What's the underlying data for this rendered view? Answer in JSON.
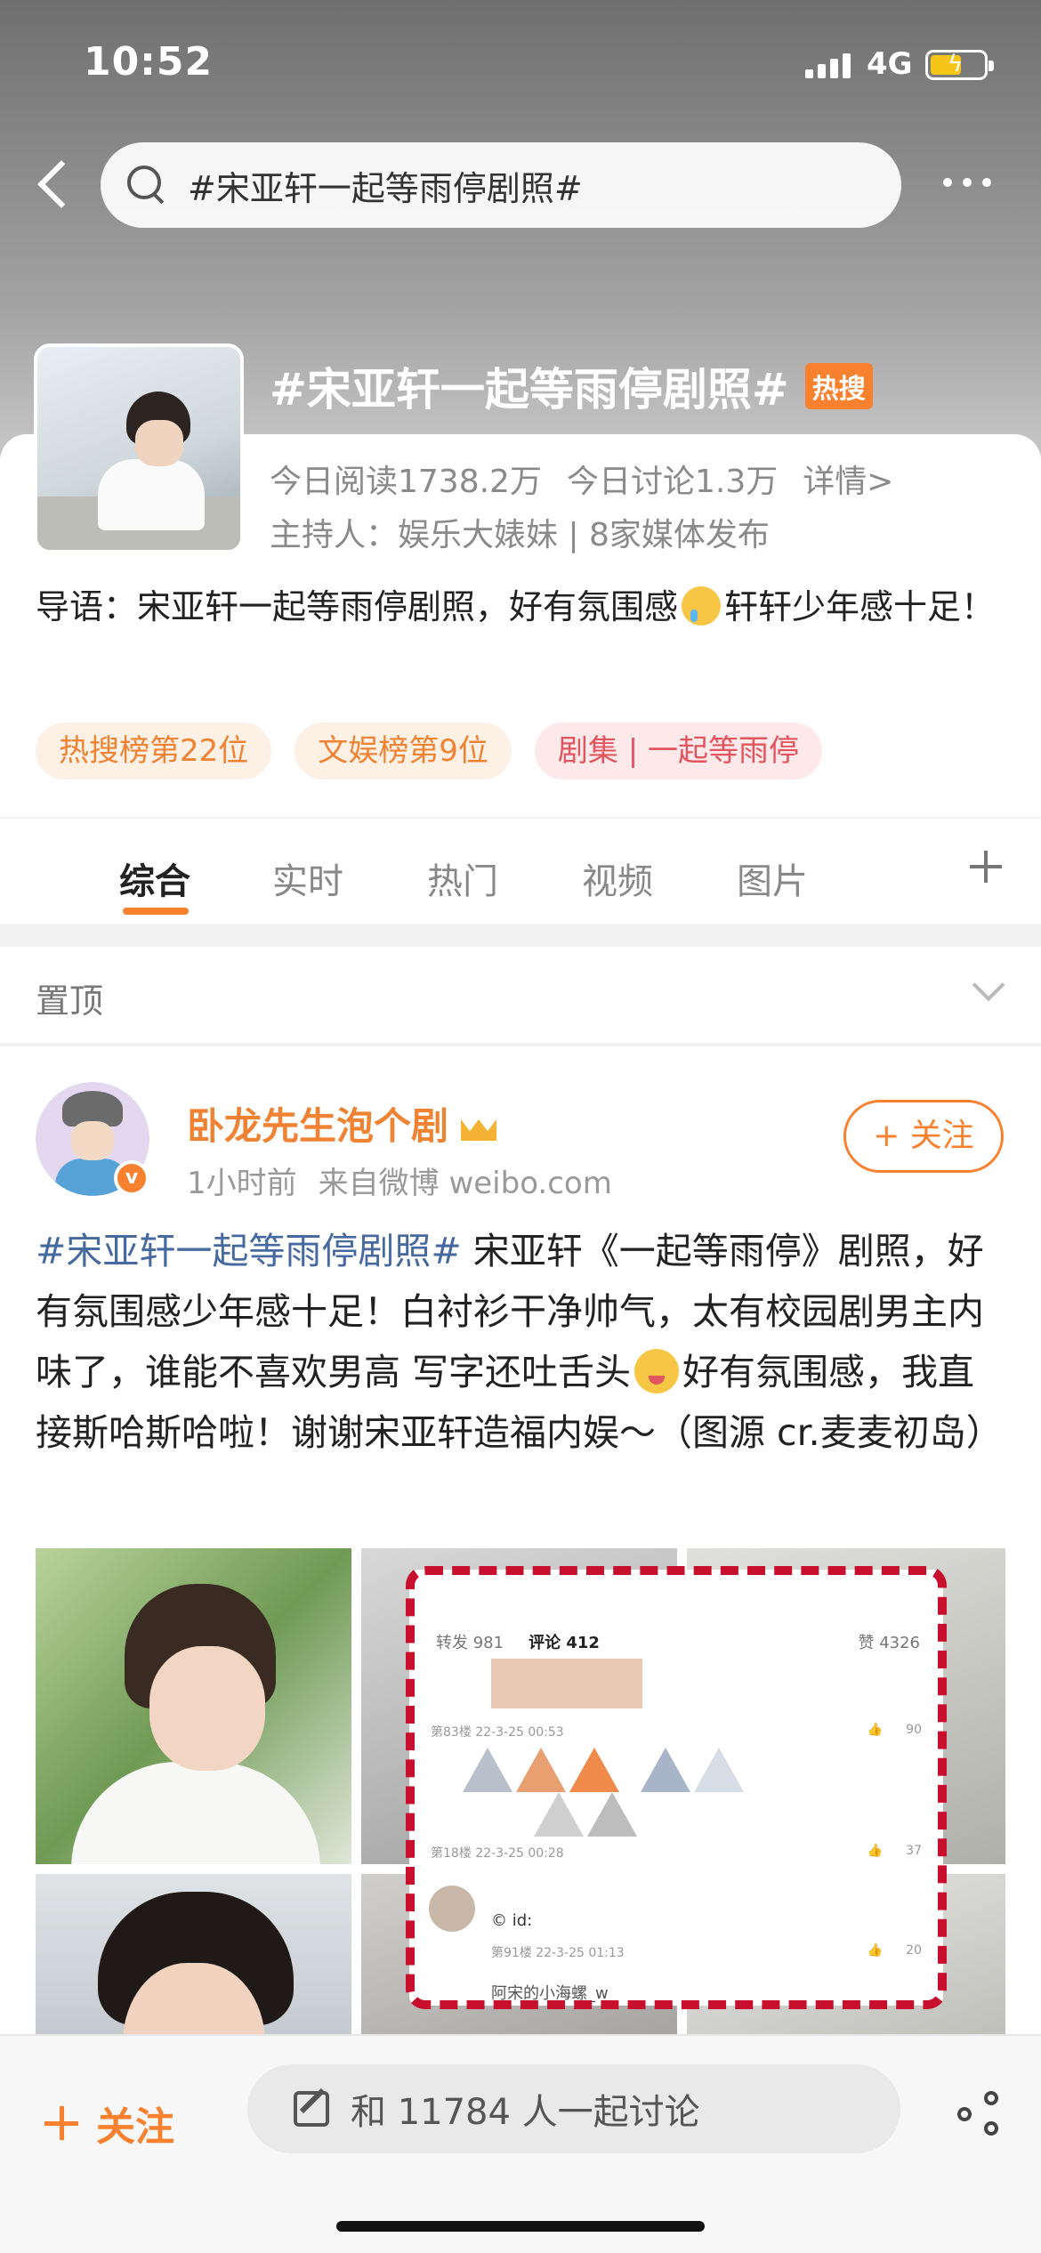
{
  "status_bar": {
    "time": "10:52",
    "network": "4G"
  },
  "search": {
    "query": "#宋亚轩一起等雨停剧照#"
  },
  "topic": {
    "title": "#宋亚轩一起等雨停剧照#",
    "hot_badge": "热搜",
    "stat_read": "今日阅读1738.2万",
    "stat_discuss": "今日讨论1.3万",
    "details_link": "详情>",
    "host": "主持人：娱乐大婊妹 | 8家媒体发布",
    "intro_prefix": "导语：宋亚轩一起等雨停剧照，好有氛围感",
    "intro_suffix": "轩轩少年感十足！",
    "tags": [
      "热搜榜第22位",
      "文娱榜第9位",
      "剧集 | 一起等雨停"
    ]
  },
  "tabs": [
    "综合",
    "实时",
    "热门",
    "视频",
    "图片"
  ],
  "pinned": {
    "label": "置顶"
  },
  "post": {
    "author": "卧龙先生泡个剧",
    "time": "1小时前",
    "source": "来自微博 weibo.com",
    "follow_label": "+ 关注",
    "topic_link": "#宋亚轩一起等雨停剧照#",
    "text_1": " 宋亚轩《一起等雨停》剧照，好有氛围感少年感十足！白衬衫干净帅气，太有校园剧男主内味了，谁能不喜欢男高 写字还吐舌头",
    "text_2": "好有氛围感，我直接斯哈斯哈啦！谢谢宋亚轩造福内娱～（图源 cr.麦麦初岛）"
  },
  "overlay": {
    "tab_repost": "转发 981",
    "tab_comment": "评论 412",
    "likes": "赞 4326",
    "row1_floor": "第83楼 22-3-25 00:53",
    "row1_likes": "90",
    "row2_floor": "第18楼 22-3-25 00:28",
    "row2_likes": "37",
    "row3_id": "© id:",
    "row3_floor": "第91楼 22-3-25 01:13",
    "row3_likes": "20",
    "last_user": "阿宋的小海螺_w"
  },
  "bottom_bar": {
    "follow_label": "关注",
    "discuss_placeholder": "和 11784 人一起讨论"
  },
  "colors": {
    "accent": "#f7812f",
    "link": "#466a9f",
    "highlight_border": "#c8102e"
  }
}
